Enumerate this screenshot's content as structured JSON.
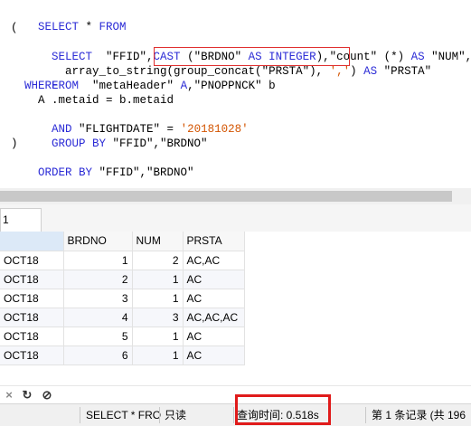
{
  "sql": {
    "line1": [
      "SELECT",
      " * ",
      "FROM"
    ],
    "line2": "(",
    "line3": {
      "kw1": "SELECT",
      "p1": "  \"FFID\",",
      "kw2": "CAST",
      "p2": " (\"BRDNO\" ",
      "kw3": "AS INTEGER",
      "p3": "),\"count\" (*) ",
      "kw4": "AS",
      "p4": " \"NUM\","
    },
    "line4": {
      "p1": "  array_to_string(",
      "p2": "group_concat(\"PRSTA\"), ",
      "s1": "','",
      "p3": ") ",
      "kw1": "AS",
      "p4": " \"PRSTA\""
    },
    "line5": {
      "kw1": "FROM",
      "p1": "  \"metaHeader\" ",
      "kw2": "A",
      "p2": ",\"PNOPPNCK\" b"
    },
    "line6": "WHERE",
    "line7": "  A .metaid = b.metaid",
    "line8": {
      "kw1": "AND",
      "p1": " \"FLIGHTDATE\" = ",
      "s1": "'20181028'"
    },
    "line9": {
      "kw1": "GROUP BY",
      "p1": " \"FFID\",\"BRDNO\""
    },
    "line10": ")",
    "line11": {
      "kw1": "ORDER BY",
      "p1": " \"FFID\",\"BRDNO\""
    }
  },
  "result_tab": {
    "label": "1"
  },
  "grid": {
    "headers": [
      "",
      "BRDNO",
      "NUM",
      "PRSTA"
    ],
    "rows": [
      [
        "OCT18",
        "1",
        "2",
        "AC,AC"
      ],
      [
        "OCT18",
        "2",
        "1",
        "AC"
      ],
      [
        "OCT18",
        "3",
        "1",
        "AC"
      ],
      [
        "OCT18",
        "4",
        "3",
        "AC,AC,AC"
      ],
      [
        "OCT18",
        "5",
        "1",
        "AC"
      ],
      [
        "OCT18",
        "6",
        "1",
        "AC"
      ]
    ]
  },
  "toolbar": {
    "icons": [
      "close-icon",
      "refresh-icon",
      "stop-icon"
    ],
    "close_glyph": "×",
    "refresh_glyph": "↻",
    "stop_glyph": "⊘"
  },
  "status": {
    "query": "SELECT * FRO",
    "readonly": "只读",
    "time": "查询时间: 0.518s",
    "record": "第 1 条记录 (共 196"
  },
  "colors": {
    "keyword": "#2b2bd6",
    "string": "#d35400",
    "highlight": "#e03030",
    "selected_header": "#dce9f7"
  }
}
